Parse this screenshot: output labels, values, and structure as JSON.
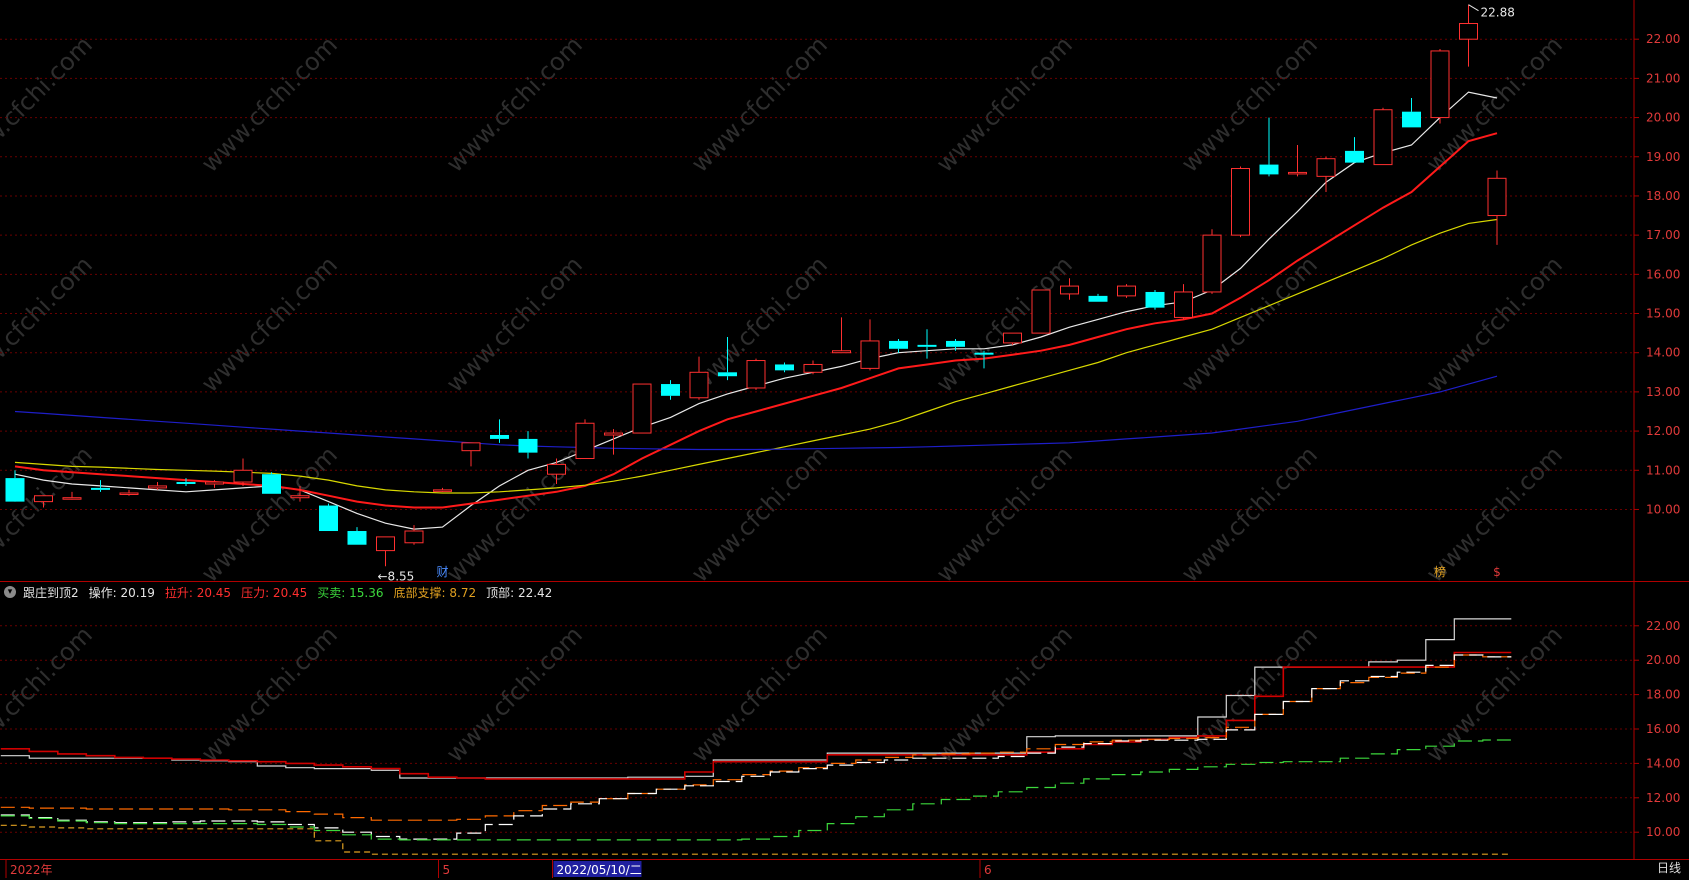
{
  "chart_data": [
    {
      "type": "candlestick",
      "panel": "main",
      "y_axis": {
        "ticks": [
          10.0,
          11.0,
          12.0,
          13.0,
          14.0,
          15.0,
          16.0,
          17.0,
          18.0,
          19.0,
          20.0,
          21.0,
          22.0
        ],
        "range": [
          8.2,
          23.0
        ]
      },
      "candles": [
        {
          "o": 10.8,
          "h": 11.0,
          "l": 10.3,
          "c": 10.2
        },
        {
          "o": 10.2,
          "h": 10.35,
          "l": 10.05,
          "c": 10.35
        },
        {
          "o": 10.3,
          "h": 10.45,
          "l": 10.25,
          "c": 10.3
        },
        {
          "o": 10.55,
          "h": 10.75,
          "l": 10.45,
          "c": 10.5
        },
        {
          "o": 10.4,
          "h": 10.5,
          "l": 10.35,
          "c": 10.42
        },
        {
          "o": 10.55,
          "h": 10.7,
          "l": 10.5,
          "c": 10.6
        },
        {
          "o": 10.7,
          "h": 10.8,
          "l": 10.6,
          "c": 10.65
        },
        {
          "o": 10.65,
          "h": 10.75,
          "l": 10.55,
          "c": 10.7
        },
        {
          "o": 10.7,
          "h": 11.3,
          "l": 10.6,
          "c": 11.0
        },
        {
          "o": 10.9,
          "h": 10.95,
          "l": 10.4,
          "c": 10.4
        },
        {
          "o": 10.3,
          "h": 10.6,
          "l": 10.2,
          "c": 10.35
        },
        {
          "o": 10.1,
          "h": 10.15,
          "l": 9.45,
          "c": 9.45
        },
        {
          "o": 9.45,
          "h": 9.55,
          "l": 9.1,
          "c": 9.1
        },
        {
          "o": 8.95,
          "h": 9.3,
          "l": 8.55,
          "c": 9.3
        },
        {
          "o": 9.15,
          "h": 9.6,
          "l": 9.1,
          "c": 9.45
        },
        {
          "o": 10.5,
          "h": 10.55,
          "l": 10.45,
          "c": 10.5
        },
        {
          "o": 11.5,
          "h": 11.6,
          "l": 11.1,
          "c": 11.7
        },
        {
          "o": 11.9,
          "h": 12.3,
          "l": 11.7,
          "c": 11.8
        },
        {
          "o": 11.8,
          "h": 12.0,
          "l": 11.3,
          "c": 11.45
        },
        {
          "o": 10.9,
          "h": 11.3,
          "l": 10.65,
          "c": 11.15
        },
        {
          "o": 11.3,
          "h": 12.3,
          "l": 11.3,
          "c": 12.2
        },
        {
          "o": 11.9,
          "h": 12.05,
          "l": 11.4,
          "c": 11.95
        },
        {
          "o": 11.95,
          "h": 13.2,
          "l": 11.95,
          "c": 13.2
        },
        {
          "o": 13.2,
          "h": 13.3,
          "l": 12.8,
          "c": 12.9
        },
        {
          "o": 12.85,
          "h": 13.9,
          "l": 12.8,
          "c": 13.5
        },
        {
          "o": 13.5,
          "h": 14.4,
          "l": 13.3,
          "c": 13.4
        },
        {
          "o": 13.1,
          "h": 13.85,
          "l": 13.05,
          "c": 13.8
        },
        {
          "o": 13.7,
          "h": 13.75,
          "l": 13.5,
          "c": 13.55
        },
        {
          "o": 13.5,
          "h": 13.8,
          "l": 13.45,
          "c": 13.7
        },
        {
          "o": 14.0,
          "h": 14.9,
          "l": 14.0,
          "c": 14.05
        },
        {
          "o": 13.6,
          "h": 14.85,
          "l": 13.55,
          "c": 14.3
        },
        {
          "o": 14.3,
          "h": 14.35,
          "l": 14.0,
          "c": 14.1
        },
        {
          "o": 14.2,
          "h": 14.6,
          "l": 13.85,
          "c": 14.15
        },
        {
          "o": 14.3,
          "h": 14.35,
          "l": 14.05,
          "c": 14.15
        },
        {
          "o": 14.0,
          "h": 14.05,
          "l": 13.6,
          "c": 13.95
        },
        {
          "o": 14.25,
          "h": 14.5,
          "l": 14.2,
          "c": 14.5
        },
        {
          "o": 14.5,
          "h": 15.6,
          "l": 14.5,
          "c": 15.6
        },
        {
          "o": 15.5,
          "h": 15.9,
          "l": 15.35,
          "c": 15.7
        },
        {
          "o": 15.45,
          "h": 15.5,
          "l": 15.3,
          "c": 15.3
        },
        {
          "o": 15.45,
          "h": 15.75,
          "l": 15.4,
          "c": 15.7
        },
        {
          "o": 15.55,
          "h": 15.6,
          "l": 15.1,
          "c": 15.15
        },
        {
          "o": 14.9,
          "h": 15.75,
          "l": 14.85,
          "c": 15.55
        },
        {
          "o": 15.55,
          "h": 17.15,
          "l": 15.5,
          "c": 17.0
        },
        {
          "o": 17.0,
          "h": 18.75,
          "l": 16.95,
          "c": 18.7
        },
        {
          "o": 18.8,
          "h": 20.0,
          "l": 18.5,
          "c": 18.55
        },
        {
          "o": 18.6,
          "h": 19.3,
          "l": 18.5,
          "c": 18.6
        },
        {
          "o": 18.5,
          "h": 19.0,
          "l": 18.1,
          "c": 18.95
        },
        {
          "o": 19.15,
          "h": 19.5,
          "l": 18.9,
          "c": 18.85
        },
        {
          "o": 18.8,
          "h": 20.25,
          "l": 18.8,
          "c": 20.2
        },
        {
          "o": 20.15,
          "h": 20.5,
          "l": 19.75,
          "c": 19.75
        },
        {
          "o": 20.0,
          "h": 21.75,
          "l": 19.85,
          "c": 21.7
        },
        {
          "o": 22.0,
          "h": 22.88,
          "l": 21.3,
          "c": 22.4
        },
        {
          "o": 17.5,
          "h": 18.65,
          "l": 16.75,
          "c": 18.45
        }
      ],
      "moving_averages": [
        {
          "color": "#e8e8e8",
          "values": [
            10.9,
            10.75,
            10.65,
            10.6,
            10.55,
            10.5,
            10.45,
            10.5,
            10.55,
            10.6,
            10.5,
            10.2,
            9.9,
            9.65,
            9.5,
            9.55,
            10.1,
            10.6,
            11.0,
            11.2,
            11.5,
            11.8,
            12.1,
            12.35,
            12.7,
            12.95,
            13.15,
            13.35,
            13.5,
            13.65,
            13.85,
            14.0,
            14.05,
            14.1,
            14.1,
            14.2,
            14.4,
            14.65,
            14.85,
            15.05,
            15.2,
            15.3,
            15.6,
            16.15,
            16.9,
            17.6,
            18.35,
            18.85,
            19.1,
            19.3,
            20.0,
            20.65,
            20.5
          ]
        },
        {
          "color": "#ff1a1a",
          "values": [
            11.1,
            11.0,
            10.95,
            10.9,
            10.85,
            10.8,
            10.75,
            10.7,
            10.65,
            10.6,
            10.5,
            10.35,
            10.2,
            10.1,
            10.05,
            10.05,
            10.15,
            10.25,
            10.35,
            10.45,
            10.6,
            10.9,
            11.3,
            11.65,
            12.0,
            12.3,
            12.5,
            12.7,
            12.9,
            13.1,
            13.35,
            13.6,
            13.7,
            13.8,
            13.85,
            13.95,
            14.05,
            14.2,
            14.4,
            14.6,
            14.75,
            14.85,
            15.0,
            15.4,
            15.85,
            16.35,
            16.8,
            17.25,
            17.7,
            18.1,
            18.75,
            19.4,
            19.6
          ]
        },
        {
          "color": "#d8d800",
          "values": [
            11.2,
            11.15,
            11.1,
            11.08,
            11.05,
            11.02,
            11.0,
            10.98,
            10.95,
            10.92,
            10.85,
            10.75,
            10.6,
            10.5,
            10.45,
            10.42,
            10.42,
            10.45,
            10.5,
            10.55,
            10.62,
            10.72,
            10.85,
            11.0,
            11.15,
            11.3,
            11.45,
            11.6,
            11.75,
            11.9,
            12.05,
            12.25,
            12.5,
            12.75,
            12.95,
            13.15,
            13.35,
            13.55,
            13.75,
            14.0,
            14.2,
            14.4,
            14.6,
            14.9,
            15.2,
            15.5,
            15.8,
            16.1,
            16.4,
            16.75,
            17.05,
            17.3,
            17.4
          ]
        },
        {
          "color": "#1e1ec8",
          "values": [
            12.5,
            12.45,
            12.4,
            12.35,
            12.3,
            12.25,
            12.2,
            12.15,
            12.1,
            12.05,
            12.0,
            11.95,
            11.9,
            11.85,
            11.8,
            11.75,
            11.7,
            11.65,
            11.62,
            11.6,
            11.58,
            11.56,
            11.55,
            11.54,
            11.53,
            11.53,
            11.53,
            11.54,
            11.55,
            11.56,
            11.57,
            11.58,
            11.6,
            11.62,
            11.64,
            11.66,
            11.68,
            11.7,
            11.75,
            11.8,
            11.85,
            11.9,
            11.95,
            12.05,
            12.15,
            12.25,
            12.4,
            12.55,
            12.7,
            12.85,
            13.0,
            13.2,
            13.4
          ]
        }
      ],
      "annotations": [
        "8.55",
        "22.88"
      ],
      "markers": [
        "财",
        "榜",
        "$"
      ]
    },
    {
      "type": "line",
      "panel": "indicator",
      "title": "跟庄到顶2",
      "legend": [
        {
          "label": "操作: 20.19",
          "color": "#e6e6e6"
        },
        {
          "label": "拉升: 20.45",
          "color": "#ff2e2e"
        },
        {
          "label": "压力: 20.45",
          "color": "#ff2e2e"
        },
        {
          "label": "买卖: 15.36",
          "color": "#3cd83c"
        },
        {
          "label": "底部支撑: 8.72",
          "color": "#e0a020"
        },
        {
          "label": "顶部: 22.42",
          "color": "#e6e6e6"
        }
      ],
      "y_axis": {
        "ticks": [
          10.0,
          12.0,
          14.0,
          16.0,
          18.0,
          20.0,
          22.0
        ],
        "range": [
          8.5,
          23.5
        ]
      },
      "series": [
        {
          "name": "顶部",
          "color": "#d8d8d8",
          "values": [
            14.45,
            14.3,
            14.3,
            14.3,
            14.3,
            14.3,
            14.2,
            14.15,
            14.1,
            13.85,
            13.75,
            13.7,
            13.7,
            13.6,
            13.15,
            13.15,
            13.15,
            13.15,
            13.15,
            13.15,
            13.15,
            13.15,
            13.2,
            13.2,
            13.25,
            14.2,
            14.2,
            14.2,
            14.2,
            14.6,
            14.6,
            14.6,
            14.6,
            14.6,
            14.6,
            14.6,
            15.55,
            15.6,
            15.6,
            15.6,
            15.6,
            15.6,
            16.7,
            17.95,
            19.6,
            19.6,
            19.6,
            19.6,
            19.9,
            20.0,
            21.2,
            22.4,
            22.4
          ]
        },
        {
          "name": "压力",
          "color": "#d00000",
          "values": [
            14.85,
            14.7,
            14.55,
            14.45,
            14.35,
            14.3,
            14.25,
            14.2,
            14.15,
            14.1,
            14.0,
            13.9,
            13.8,
            13.7,
            13.4,
            13.2,
            13.15,
            13.1,
            13.1,
            13.1,
            13.1,
            13.1,
            13.1,
            13.1,
            13.5,
            14.1,
            14.1,
            14.1,
            14.1,
            14.5,
            14.5,
            14.5,
            14.5,
            14.5,
            14.5,
            14.5,
            14.65,
            14.85,
            15.1,
            15.25,
            15.4,
            15.5,
            15.6,
            16.5,
            17.9,
            19.6,
            19.6,
            19.6,
            19.6,
            19.6,
            19.6,
            20.45,
            20.45
          ]
        },
        {
          "name": "拉升",
          "color": "#ff6a00",
          "values": [
            11.45,
            11.4,
            11.4,
            11.35,
            11.35,
            11.35,
            11.35,
            11.35,
            11.3,
            11.3,
            11.2,
            11.05,
            10.85,
            10.7,
            10.7,
            10.7,
            10.75,
            10.95,
            11.25,
            11.55,
            11.75,
            11.95,
            12.25,
            12.5,
            12.75,
            13.05,
            13.35,
            13.55,
            13.75,
            14.0,
            14.2,
            14.35,
            14.5,
            14.55,
            14.6,
            14.65,
            14.85,
            15.1,
            15.25,
            15.35,
            15.4,
            15.45,
            15.5,
            16.1,
            16.85,
            17.6,
            18.35,
            18.7,
            19.0,
            19.25,
            19.6,
            20.3,
            20.2
          ]
        },
        {
          "name": "操作",
          "color": "#ffffff",
          "values": [
            11.0,
            10.85,
            10.7,
            10.6,
            10.55,
            10.55,
            10.6,
            10.65,
            10.65,
            10.6,
            10.45,
            10.25,
            10.0,
            9.75,
            9.6,
            9.6,
            9.95,
            10.45,
            10.95,
            11.35,
            11.65,
            11.95,
            12.25,
            12.5,
            12.7,
            12.95,
            13.25,
            13.5,
            13.7,
            13.9,
            14.05,
            14.2,
            14.3,
            14.3,
            14.3,
            14.4,
            14.6,
            14.95,
            15.15,
            15.3,
            15.35,
            15.35,
            15.4,
            15.95,
            16.85,
            17.6,
            18.35,
            18.8,
            19.05,
            19.3,
            19.7,
            20.3,
            20.19
          ]
        },
        {
          "name": "买卖",
          "color": "#3cd83c",
          "values": [
            10.95,
            10.8,
            10.65,
            10.55,
            10.5,
            10.5,
            10.5,
            10.5,
            10.5,
            10.45,
            10.3,
            10.1,
            9.85,
            9.6,
            9.55,
            9.55,
            9.55,
            9.55,
            9.55,
            9.55,
            9.55,
            9.55,
            9.55,
            9.55,
            9.55,
            9.55,
            9.6,
            9.75,
            10.1,
            10.5,
            10.9,
            11.3,
            11.65,
            11.9,
            12.1,
            12.35,
            12.6,
            12.85,
            13.1,
            13.35,
            13.5,
            13.65,
            13.8,
            13.95,
            14.05,
            14.1,
            14.1,
            14.3,
            14.55,
            14.8,
            15.0,
            15.3,
            15.36
          ]
        },
        {
          "name": "底部支撑",
          "color": "#e0a020",
          "values": [
            10.4,
            10.3,
            10.25,
            10.2,
            10.2,
            10.2,
            10.2,
            10.2,
            10.2,
            10.2,
            10.2,
            9.5,
            8.85,
            8.72,
            8.72,
            8.72,
            8.72,
            8.72,
            8.72,
            8.72,
            8.72,
            8.72,
            8.72,
            8.72,
            8.72,
            8.72,
            8.72,
            8.72,
            8.72,
            8.72,
            8.72,
            8.72,
            8.72,
            8.72,
            8.72,
            8.72,
            8.72,
            8.72,
            8.72,
            8.72,
            8.72,
            8.72,
            8.72,
            8.72,
            8.72,
            8.72,
            8.72,
            8.72,
            8.72,
            8.72,
            8.72,
            8.72,
            8.72
          ]
        }
      ]
    }
  ],
  "time_axis": {
    "labels": [
      {
        "text": "2022年",
        "index": 0,
        "color": "#e03a3a",
        "highlight": false
      },
      {
        "text": "5",
        "index": 15,
        "color": "#e03a3a",
        "highlight": false
      },
      {
        "text": "2022/05/10/二",
        "index": 19,
        "color": "#ffffff",
        "highlight": true
      },
      {
        "text": "6",
        "index": 34,
        "color": "#e03a3a",
        "highlight": false
      }
    ]
  },
  "period_label": "日线",
  "watermark": "www.cfchi.com",
  "colors": {
    "up": "#ff3030",
    "down": "#00ffff",
    "grid": "#6a0000",
    "axis": "#b00000",
    "tick": "#e03a3a",
    "background": "#000000"
  }
}
